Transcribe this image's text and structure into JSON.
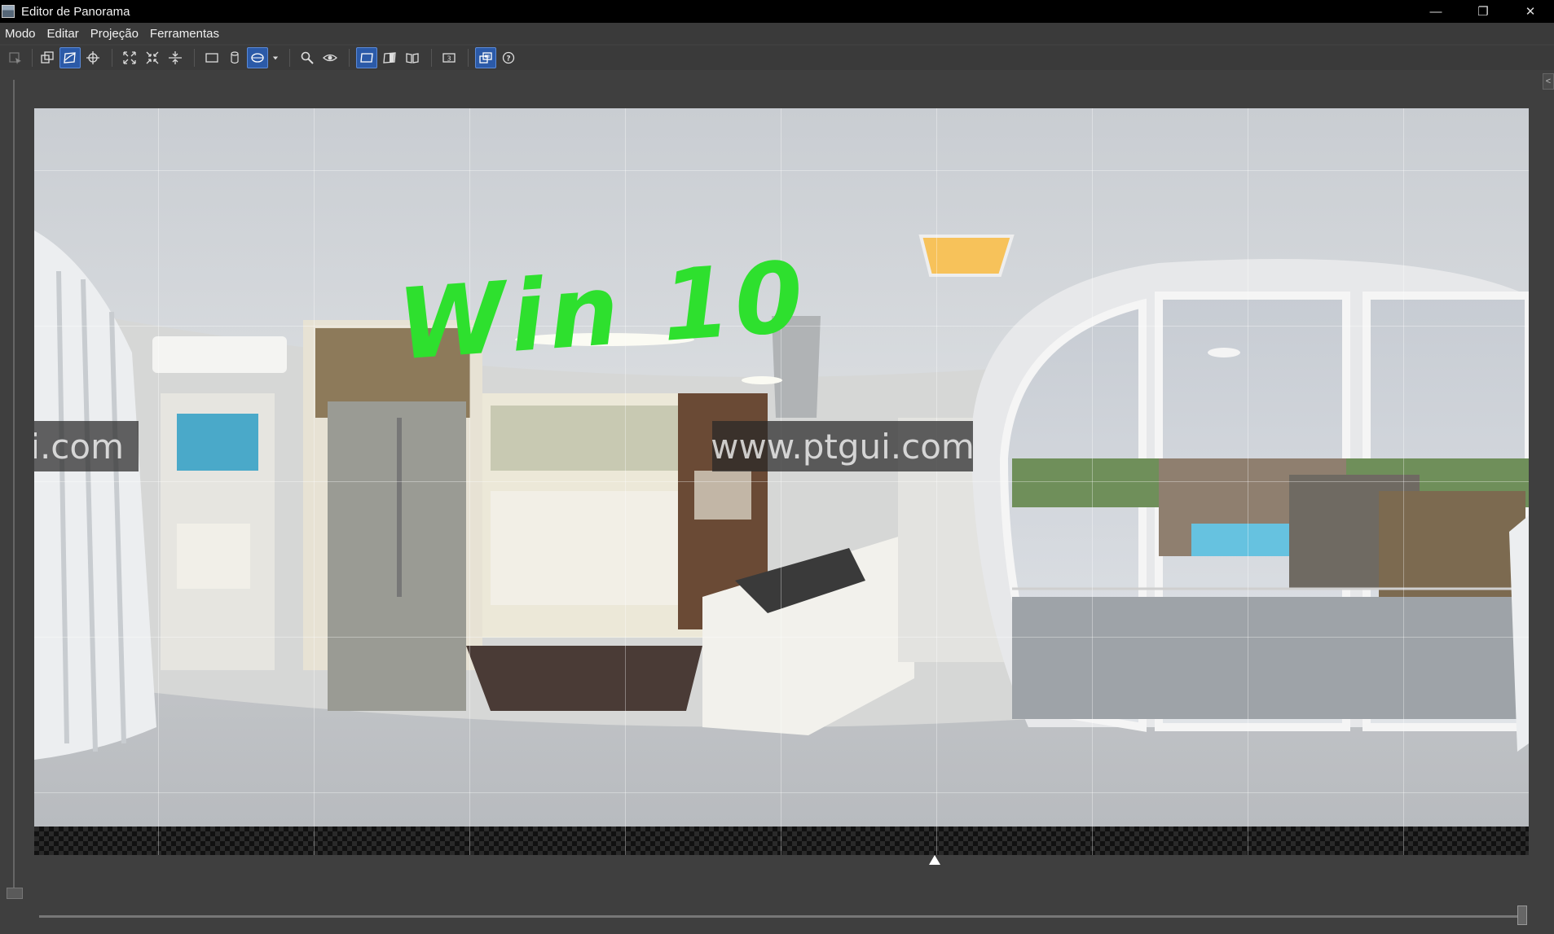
{
  "window": {
    "title": "Editor de Panorama",
    "minimize": "—",
    "restore": "❐",
    "close": "✕"
  },
  "menu": {
    "items": [
      "Modo",
      "Editar",
      "Projeção",
      "Ferramentas"
    ]
  },
  "toolbar": {
    "groups": [
      [
        "select-icon"
      ],
      [
        "move-image-icon",
        "drag-icon",
        "center-point-icon"
      ],
      [
        "fit-icon",
        "shrink-icon",
        "straighten-icon"
      ],
      [
        "rectilinear-icon",
        "cylindrical-icon",
        "equirectangular-icon",
        "projection-dropdown-icon"
      ],
      [
        "zoom-icon",
        "preview-icon"
      ],
      [
        "grid-icon",
        "half-icon",
        "pages-icon"
      ],
      [
        "number-3-icon"
      ],
      [
        "layers-icon",
        "help-icon"
      ]
    ],
    "active": [
      "drag-icon",
      "equirectangular-icon",
      "grid-icon",
      "layers-icon"
    ]
  },
  "canvas": {
    "annotation": "Win 10",
    "watermark_left": "ui.com",
    "watermark_center": "www.ptgui.com",
    "grid_columns": 12,
    "grid_rows": 5
  },
  "colors": {
    "annotation": "#2ee02e",
    "active_button": "#2b5aa8",
    "background": "#3f3f3f"
  }
}
